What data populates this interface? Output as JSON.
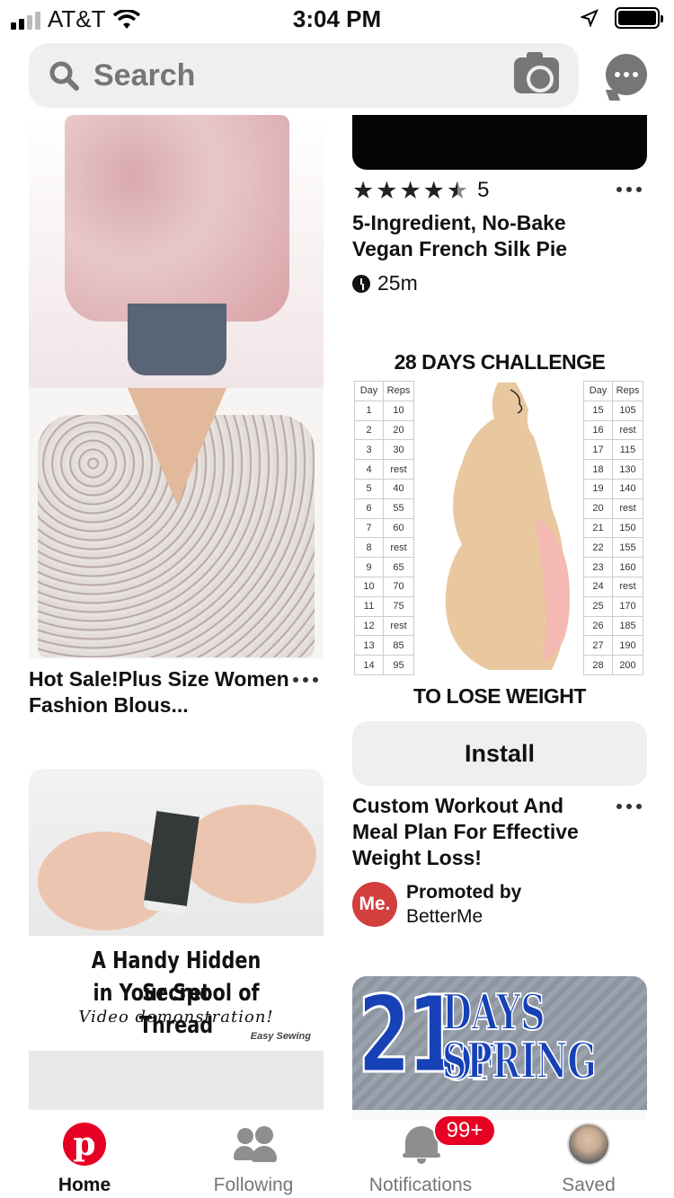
{
  "status_bar": {
    "carrier": "AT&T",
    "time": "3:04 PM",
    "signal_bars": 2,
    "signal_bars_total": 4,
    "battery_level": 1.0
  },
  "search": {
    "placeholder": "Search",
    "icons": [
      "search-icon",
      "camera-icon",
      "chat-icon"
    ]
  },
  "left_pins": {
    "blouse_title": "Hot Sale!Plus Size Women Fashion Blous...",
    "spool": {
      "line1": "A Handy Hidden Secret",
      "line2": "in Your Spool of Thread",
      "line3": "Video demonstration!",
      "brand": "Easy Sewing"
    }
  },
  "right_pins": {
    "recipe": {
      "rating": 4.5,
      "score": "5",
      "title": "5-Ingredient, No-Bake Vegan French Silk Pie",
      "duration": "25m"
    },
    "challenge": {
      "heading": "28 DAYS CHALLENGE",
      "footer": "TO LOSE WEIGHT",
      "col_day": "Day",
      "col_reps": "Reps",
      "rows_left": [
        [
          "1",
          "10"
        ],
        [
          "2",
          "20"
        ],
        [
          "3",
          "30"
        ],
        [
          "4",
          "rest"
        ],
        [
          "5",
          "40"
        ],
        [
          "6",
          "55"
        ],
        [
          "7",
          "60"
        ],
        [
          "8",
          "rest"
        ],
        [
          "9",
          "65"
        ],
        [
          "10",
          "70"
        ],
        [
          "11",
          "75"
        ],
        [
          "12",
          "rest"
        ],
        [
          "13",
          "85"
        ],
        [
          "14",
          "95"
        ]
      ],
      "rows_right": [
        [
          "15",
          "105"
        ],
        [
          "16",
          "rest"
        ],
        [
          "17",
          "115"
        ],
        [
          "18",
          "130"
        ],
        [
          "19",
          "140"
        ],
        [
          "20",
          "rest"
        ],
        [
          "21",
          "150"
        ],
        [
          "22",
          "155"
        ],
        [
          "23",
          "160"
        ],
        [
          "24",
          "rest"
        ],
        [
          "25",
          "170"
        ],
        [
          "26",
          "185"
        ],
        [
          "27",
          "190"
        ],
        [
          "28",
          "200"
        ]
      ]
    },
    "install_label": "Install",
    "ad": {
      "title": "Custom Workout And Meal Plan For Effective Weight Loss!",
      "promoted_label": "Promoted by",
      "advertiser": "BetterMe",
      "logo_text": "Me."
    },
    "spring": {
      "number": "21",
      "line1": "DAYS OF",
      "line2": "SPRING"
    }
  },
  "tabbar": {
    "tabs": [
      {
        "label": "Home",
        "icon": "pinterest-logo-icon",
        "active": true
      },
      {
        "label": "Following",
        "icon": "people-icon",
        "active": false
      },
      {
        "label": "Notifications",
        "icon": "bell-icon",
        "active": false
      },
      {
        "label": "Saved",
        "icon": "avatar",
        "active": false
      }
    ],
    "notification_badge": "99+"
  },
  "colors": {
    "brand_red": "#e60023",
    "search_bg": "#efefef",
    "muted_text": "#767676",
    "promo_red": "#d23f3d"
  }
}
